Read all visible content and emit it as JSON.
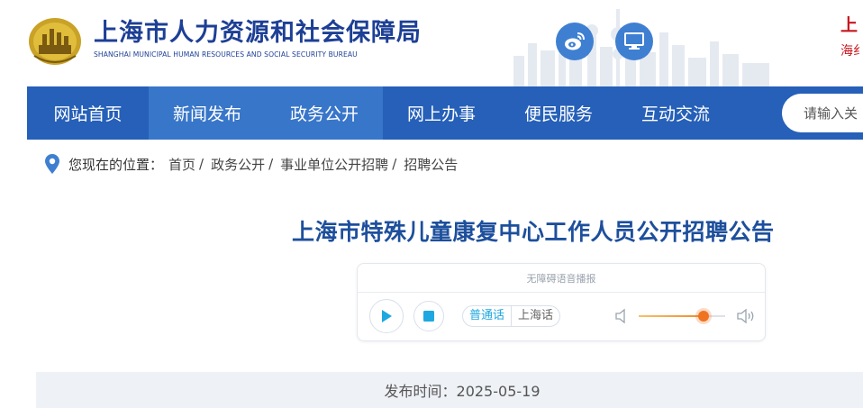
{
  "header": {
    "title": "上海市人力资源和社会保障局",
    "subtitle": "SHANGHAI MUNICIPAL HUMAN RESOURCES AND SOCIAL SECURITY BUREAU",
    "right_line1": "上",
    "right_line2": "海纟",
    "icons": [
      "weibo-icon",
      "computer-icon"
    ],
    "brand_color": "#1d3f95",
    "accent_color": "#3f7fd1"
  },
  "nav": {
    "items": [
      {
        "label": "网站首页",
        "width": 135
      },
      {
        "label": "新闻发布",
        "width": 130
      },
      {
        "label": "政务公开",
        "width": 130
      },
      {
        "label": "网上办事",
        "width": 130
      },
      {
        "label": "便民服务",
        "width": 130
      },
      {
        "label": "互动交流",
        "width": 130
      }
    ],
    "search_placeholder": "请输入关",
    "bar_color": "#2660b8"
  },
  "breadcrumb": {
    "prefix": "您现在的位置：",
    "items": [
      "首页",
      "政务公开",
      "事业单位公开招聘",
      "招聘公告"
    ],
    "separator": "/"
  },
  "article": {
    "title": "上海市特殊儿童康复中心工作人员公开招聘公告",
    "publish_label": "发布时间：",
    "publish_date": "2025-05-19"
  },
  "player": {
    "header": "无障碍语音播报",
    "lang_mandarin": "普通话",
    "lang_shanghai": "上海话",
    "volume_level": 0.75
  }
}
